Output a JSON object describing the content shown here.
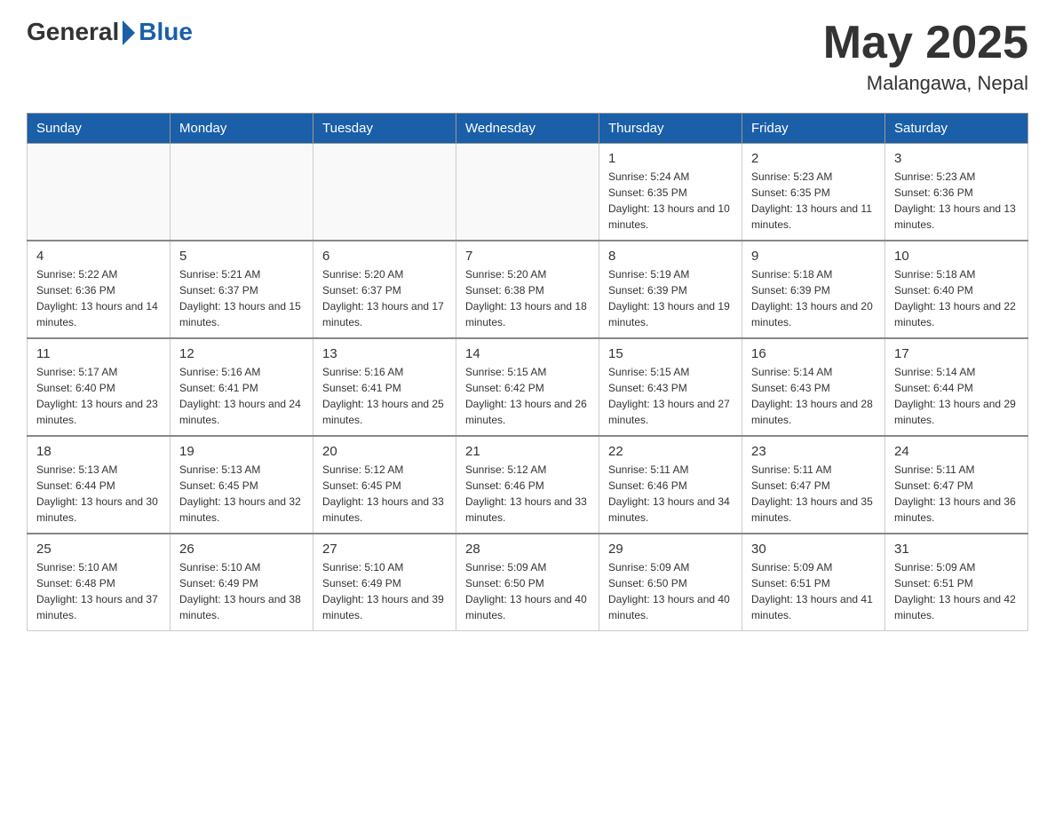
{
  "header": {
    "logo_general": "General",
    "logo_blue": "Blue",
    "month_title": "May 2025",
    "location": "Malangawa, Nepal"
  },
  "days_of_week": [
    "Sunday",
    "Monday",
    "Tuesday",
    "Wednesday",
    "Thursday",
    "Friday",
    "Saturday"
  ],
  "weeks": [
    [
      {
        "day": "",
        "info": ""
      },
      {
        "day": "",
        "info": ""
      },
      {
        "day": "",
        "info": ""
      },
      {
        "day": "",
        "info": ""
      },
      {
        "day": "1",
        "info": "Sunrise: 5:24 AM\nSunset: 6:35 PM\nDaylight: 13 hours and 10 minutes."
      },
      {
        "day": "2",
        "info": "Sunrise: 5:23 AM\nSunset: 6:35 PM\nDaylight: 13 hours and 11 minutes."
      },
      {
        "day": "3",
        "info": "Sunrise: 5:23 AM\nSunset: 6:36 PM\nDaylight: 13 hours and 13 minutes."
      }
    ],
    [
      {
        "day": "4",
        "info": "Sunrise: 5:22 AM\nSunset: 6:36 PM\nDaylight: 13 hours and 14 minutes."
      },
      {
        "day": "5",
        "info": "Sunrise: 5:21 AM\nSunset: 6:37 PM\nDaylight: 13 hours and 15 minutes."
      },
      {
        "day": "6",
        "info": "Sunrise: 5:20 AM\nSunset: 6:37 PM\nDaylight: 13 hours and 17 minutes."
      },
      {
        "day": "7",
        "info": "Sunrise: 5:20 AM\nSunset: 6:38 PM\nDaylight: 13 hours and 18 minutes."
      },
      {
        "day": "8",
        "info": "Sunrise: 5:19 AM\nSunset: 6:39 PM\nDaylight: 13 hours and 19 minutes."
      },
      {
        "day": "9",
        "info": "Sunrise: 5:18 AM\nSunset: 6:39 PM\nDaylight: 13 hours and 20 minutes."
      },
      {
        "day": "10",
        "info": "Sunrise: 5:18 AM\nSunset: 6:40 PM\nDaylight: 13 hours and 22 minutes."
      }
    ],
    [
      {
        "day": "11",
        "info": "Sunrise: 5:17 AM\nSunset: 6:40 PM\nDaylight: 13 hours and 23 minutes."
      },
      {
        "day": "12",
        "info": "Sunrise: 5:16 AM\nSunset: 6:41 PM\nDaylight: 13 hours and 24 minutes."
      },
      {
        "day": "13",
        "info": "Sunrise: 5:16 AM\nSunset: 6:41 PM\nDaylight: 13 hours and 25 minutes."
      },
      {
        "day": "14",
        "info": "Sunrise: 5:15 AM\nSunset: 6:42 PM\nDaylight: 13 hours and 26 minutes."
      },
      {
        "day": "15",
        "info": "Sunrise: 5:15 AM\nSunset: 6:43 PM\nDaylight: 13 hours and 27 minutes."
      },
      {
        "day": "16",
        "info": "Sunrise: 5:14 AM\nSunset: 6:43 PM\nDaylight: 13 hours and 28 minutes."
      },
      {
        "day": "17",
        "info": "Sunrise: 5:14 AM\nSunset: 6:44 PM\nDaylight: 13 hours and 29 minutes."
      }
    ],
    [
      {
        "day": "18",
        "info": "Sunrise: 5:13 AM\nSunset: 6:44 PM\nDaylight: 13 hours and 30 minutes."
      },
      {
        "day": "19",
        "info": "Sunrise: 5:13 AM\nSunset: 6:45 PM\nDaylight: 13 hours and 32 minutes."
      },
      {
        "day": "20",
        "info": "Sunrise: 5:12 AM\nSunset: 6:45 PM\nDaylight: 13 hours and 33 minutes."
      },
      {
        "day": "21",
        "info": "Sunrise: 5:12 AM\nSunset: 6:46 PM\nDaylight: 13 hours and 33 minutes."
      },
      {
        "day": "22",
        "info": "Sunrise: 5:11 AM\nSunset: 6:46 PM\nDaylight: 13 hours and 34 minutes."
      },
      {
        "day": "23",
        "info": "Sunrise: 5:11 AM\nSunset: 6:47 PM\nDaylight: 13 hours and 35 minutes."
      },
      {
        "day": "24",
        "info": "Sunrise: 5:11 AM\nSunset: 6:47 PM\nDaylight: 13 hours and 36 minutes."
      }
    ],
    [
      {
        "day": "25",
        "info": "Sunrise: 5:10 AM\nSunset: 6:48 PM\nDaylight: 13 hours and 37 minutes."
      },
      {
        "day": "26",
        "info": "Sunrise: 5:10 AM\nSunset: 6:49 PM\nDaylight: 13 hours and 38 minutes."
      },
      {
        "day": "27",
        "info": "Sunrise: 5:10 AM\nSunset: 6:49 PM\nDaylight: 13 hours and 39 minutes."
      },
      {
        "day": "28",
        "info": "Sunrise: 5:09 AM\nSunset: 6:50 PM\nDaylight: 13 hours and 40 minutes."
      },
      {
        "day": "29",
        "info": "Sunrise: 5:09 AM\nSunset: 6:50 PM\nDaylight: 13 hours and 40 minutes."
      },
      {
        "day": "30",
        "info": "Sunrise: 5:09 AM\nSunset: 6:51 PM\nDaylight: 13 hours and 41 minutes."
      },
      {
        "day": "31",
        "info": "Sunrise: 5:09 AM\nSunset: 6:51 PM\nDaylight: 13 hours and 42 minutes."
      }
    ]
  ]
}
